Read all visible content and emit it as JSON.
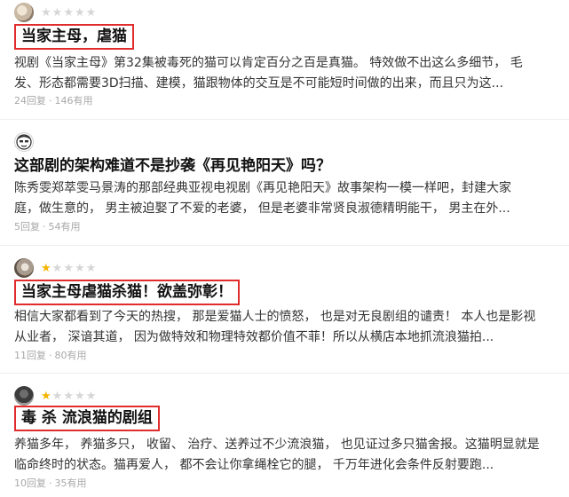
{
  "reviews": [
    {
      "rating": 0,
      "title": "当家主母，虐猫",
      "highlighted": true,
      "lines": [
        "视剧《当家主母》第32集被毒死的猫可以肯定百分之百是真猫。 特效做不出这么多细节， 毛",
        "发、形态都需要3D扫描、建模，猫跟物体的交互是不可能短时间做的出来，而且只为这..."
      ],
      "replies": "24回复",
      "useful": "146有用"
    },
    {
      "rating": null,
      "title": "这部剧的架构难道不是抄袭《再见艳阳天》吗？",
      "highlighted": false,
      "lines": [
        "陈秀雯郑萃雯马景涛的那部经典亚视电视剧《再见艳阳天》故事架构一模一样吧，封建大家",
        "庭，做生意的， 男主被迫娶了不爱的老婆， 但是老婆非常贤良淑德精明能干， 男主在外..."
      ],
      "replies": "5回复",
      "useful": "54有用"
    },
    {
      "rating": 1,
      "title": "当家主母虐猫杀猫！欲盖弥彰！",
      "highlighted": true,
      "lines": [
        "相信大家都看到了今天的热搜， 那是爱猫人士的愤怒， 也是对无良剧组的谴责！ 本人也是影视",
        "从业者， 深谙其道， 因为做特效和物理特效都价值不菲！所以从横店本地抓流浪猫拍..."
      ],
      "replies": "11回复",
      "useful": "80有用"
    },
    {
      "rating": 1,
      "title": "毒 杀 流浪猫的剧组",
      "highlighted": true,
      "lines": [
        "养猫多年， 养猫多只， 收留、 治疗、送养过不少流浪猫， 也见证过多只猫舍报。这猫明显就是",
        "临命终时的状态。猫再爱人， 都不会让你拿绳栓它的腿， 千万年进化会条件反射要跑..."
      ],
      "replies": "10回复",
      "useful": "35有用"
    }
  ],
  "meta_separator": "·",
  "star_glyph": "★",
  "colors": {
    "highlight_border": "#e02c2c",
    "star_on": "#f5b400",
    "star_off": "#d6d6d6",
    "meta_text": "#a8a8a8"
  }
}
